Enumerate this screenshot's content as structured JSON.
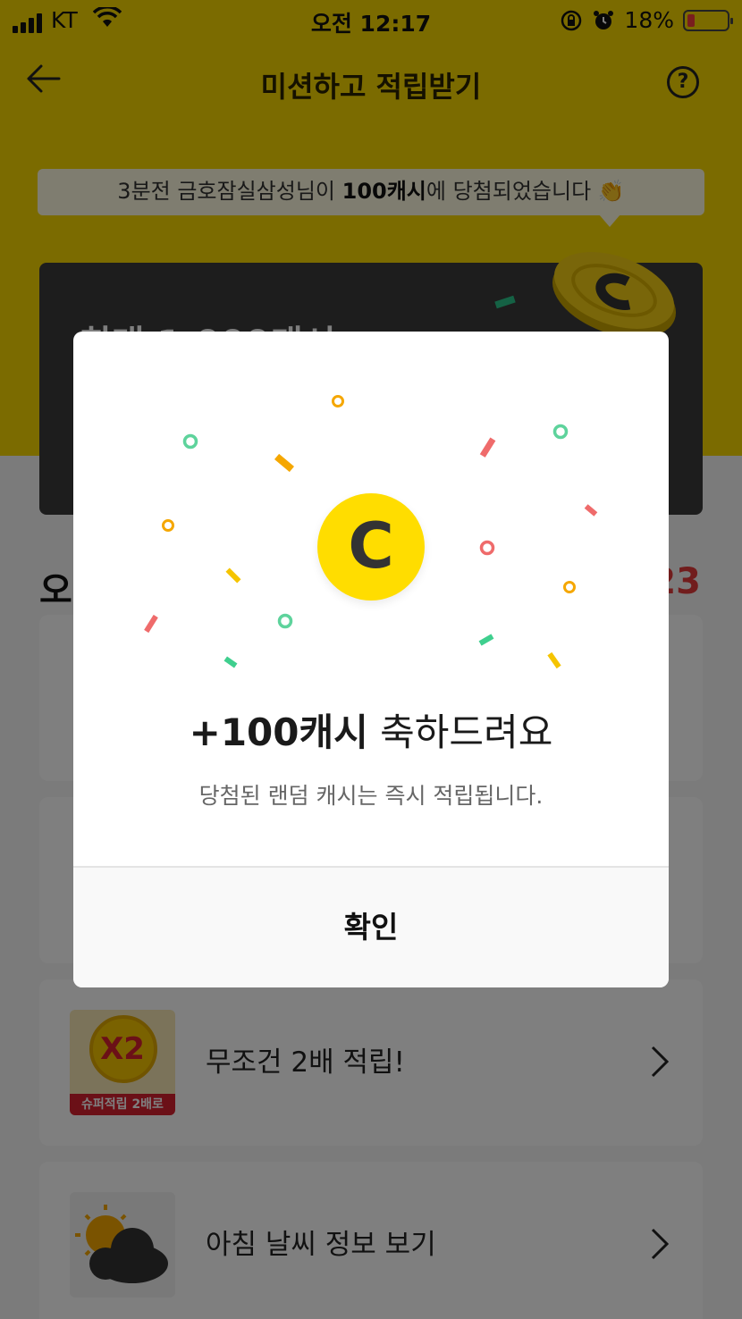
{
  "status_bar": {
    "carrier": "KT",
    "time": "오전 12:17",
    "battery": "18%",
    "battery_level": 0.18
  },
  "header": {
    "title": "미션하고 적립받기",
    "help_glyph": "?"
  },
  "ticker": {
    "prefix": "3분전 금호잠실삼성님이 ",
    "highlight": "100캐시",
    "suffix": "에 당첨되었습니다",
    "emoji": "👏"
  },
  "promo": {
    "text": "최대 1,000캐시"
  },
  "missions": {
    "section_title": "오",
    "count": "23",
    "items": [
      {
        "label": "",
        "icon": "mission-icon"
      },
      {
        "label": "",
        "icon": "mission-icon"
      },
      {
        "label": "무조건 2배 적립!",
        "icon": "double-coin-icon",
        "badge_main": "X2",
        "badge_sub": "슈퍼적립 2배로"
      },
      {
        "label": "아침 날씨 정보 보기",
        "icon": "sun-cloud-icon"
      }
    ]
  },
  "modal": {
    "coin_letter": "C",
    "title_bold": "+100캐시",
    "title_rest": " 축하드려요",
    "subtitle": "당첨된 랜덤 캐시는 즉시 적립됩니다.",
    "confirm_label": "확인"
  },
  "colors": {
    "brand_yellow": "#f7d600",
    "coin_yellow": "#ffdd00",
    "count_red": "#e23b3b",
    "dim_overlay": "rgba(0,0,0,0.5)"
  }
}
